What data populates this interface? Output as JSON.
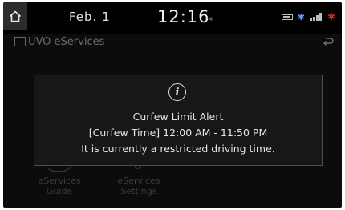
{
  "status_bar": {
    "date": "Feb. 1",
    "time": "12:16",
    "ampm": "PM",
    "icons": [
      "battery-icon",
      "bluetooth-icon",
      "signal-icon",
      "star-icon"
    ],
    "colors": {
      "bluetooth": "#5aa0ff",
      "alert_star": "#e02020"
    }
  },
  "app_header": {
    "title": "UVO eServices"
  },
  "background_tiles": [
    {
      "label_line1": "eServices",
      "label_line2": "Guide"
    },
    {
      "label_line1": "eServices",
      "label_line2": "Settings"
    }
  ],
  "popup": {
    "icon": "info-icon",
    "title": "Curfew Limit Alert",
    "detail": "[Curfew Time] 12:00 AM - 11:50 PM",
    "message": "It is currently a restricted driving time."
  }
}
